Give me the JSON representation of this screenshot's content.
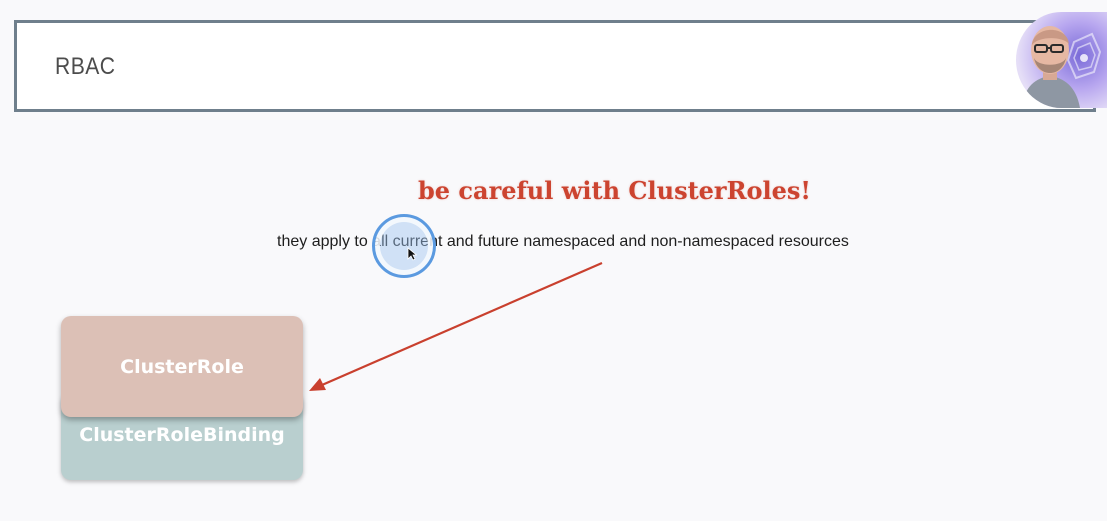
{
  "slide": {
    "title": "RBAC",
    "warning": "be careful with ClusterRoles!",
    "subtext": "they apply to all current and future namespaced and non-namespaced resources",
    "boxes": {
      "cluster_role": "ClusterRole",
      "cluster_role_binding": "ClusterRoleBinding"
    }
  },
  "colors": {
    "warning": "#cc4430",
    "arrow": "#c9402e",
    "cluster_role_box": "#dcc0b6",
    "cluster_role_binding_box": "#b9cfcf",
    "header_border": "#6f7f8c",
    "click_ring": "#5b9ae0"
  },
  "icons": {
    "cursor": "mouse-pointer-icon",
    "click": "click-indicator-icon"
  }
}
